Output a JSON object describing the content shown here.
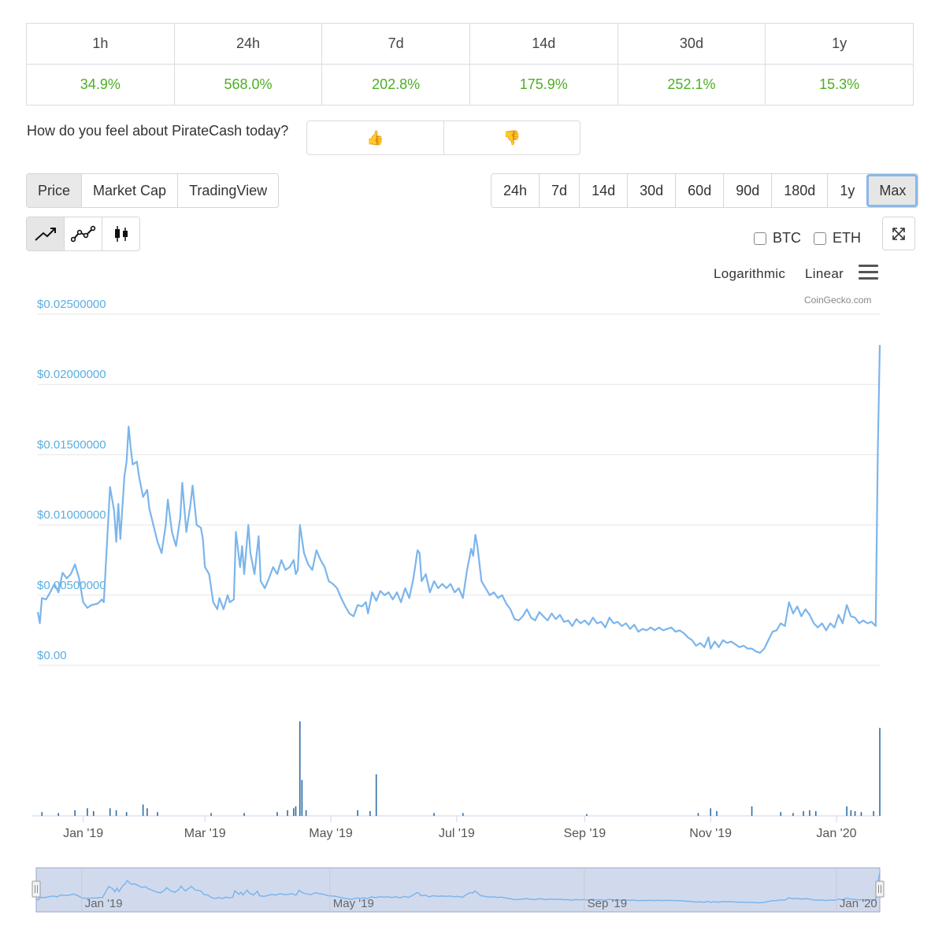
{
  "change": {
    "periods": [
      "1h",
      "24h",
      "7d",
      "14d",
      "30d",
      "1y"
    ],
    "values": [
      "34.9%",
      "568.0%",
      "202.8%",
      "175.9%",
      "252.1%",
      "15.3%"
    ]
  },
  "sentiment": {
    "question": "How do you feel about PirateCash today?",
    "up_icon": "👍",
    "down_icon": "👎"
  },
  "tabs": [
    "Price",
    "Market Cap",
    "TradingView"
  ],
  "ranges": [
    "24h",
    "7d",
    "14d",
    "30d",
    "60d",
    "90d",
    "180d",
    "1y",
    "Max"
  ],
  "compare": {
    "btc": "BTC",
    "eth": "ETH"
  },
  "scale": {
    "log": "Logarithmic",
    "linear": "Linear"
  },
  "credit": "CoinGecko.com",
  "colors": {
    "line": "#7cb5ec",
    "volume": "#2f6ca4",
    "axis_label": "#5aaee0",
    "green": "#4caf22"
  },
  "chart_data": {
    "type": "line",
    "ylim": [
      0,
      0.025
    ],
    "yticks": [
      "$0.02500000",
      "$0.02000000",
      "$0.01500000",
      "$0.01000000",
      "$0.00500000",
      "$0.00"
    ],
    "xticks": [
      "Jan '19",
      "Mar '19",
      "May '19",
      "Jul '19",
      "Sep '19",
      "Nov '19",
      "Jan '20"
    ],
    "navigator_ticks": [
      "Jan '19",
      "May '19",
      "Sep '19",
      "Jan '20"
    ],
    "x_start": "2018-12-10",
    "x_end": "2020-01-22",
    "series": [
      {
        "type": "price",
        "points": [
          [
            "2018-12-10",
            0.0038
          ],
          [
            "2018-12-11",
            0.003
          ],
          [
            "2018-12-12",
            0.0048
          ],
          [
            "2018-12-14",
            0.0047
          ],
          [
            "2018-12-16",
            0.0052
          ],
          [
            "2018-12-18",
            0.0058
          ],
          [
            "2018-12-20",
            0.0052
          ],
          [
            "2018-12-22",
            0.0066
          ],
          [
            "2018-12-24",
            0.0062
          ],
          [
            "2018-12-26",
            0.0065
          ],
          [
            "2018-12-28",
            0.0072
          ],
          [
            "2018-12-30",
            0.0062
          ],
          [
            "2019-01-01",
            0.0045
          ],
          [
            "2019-01-03",
            0.0041
          ],
          [
            "2019-01-05",
            0.0043
          ],
          [
            "2019-01-08",
            0.0044
          ],
          [
            "2019-01-10",
            0.0047
          ],
          [
            "2019-01-11",
            0.0045
          ],
          [
            "2019-01-13",
            0.01
          ],
          [
            "2019-01-14",
            0.0127
          ],
          [
            "2019-01-16",
            0.011
          ],
          [
            "2019-01-17",
            0.0088
          ],
          [
            "2019-01-18",
            0.0115
          ],
          [
            "2019-01-19",
            0.009
          ],
          [
            "2019-01-21",
            0.0135
          ],
          [
            "2019-01-22",
            0.0145
          ],
          [
            "2019-01-23",
            0.017
          ],
          [
            "2019-01-24",
            0.0155
          ],
          [
            "2019-01-25",
            0.0143
          ],
          [
            "2019-01-27",
            0.0145
          ],
          [
            "2019-01-28",
            0.0135
          ],
          [
            "2019-01-30",
            0.012
          ],
          [
            "2019-02-01",
            0.0125
          ],
          [
            "2019-02-02",
            0.0112
          ],
          [
            "2019-02-04",
            0.01
          ],
          [
            "2019-02-06",
            0.0088
          ],
          [
            "2019-02-08",
            0.008
          ],
          [
            "2019-02-10",
            0.01
          ],
          [
            "2019-02-11",
            0.0118
          ],
          [
            "2019-02-13",
            0.0095
          ],
          [
            "2019-02-15",
            0.0085
          ],
          [
            "2019-02-17",
            0.0105
          ],
          [
            "2019-02-18",
            0.013
          ],
          [
            "2019-02-20",
            0.0095
          ],
          [
            "2019-02-22",
            0.0115
          ],
          [
            "2019-02-23",
            0.0128
          ],
          [
            "2019-02-25",
            0.01
          ],
          [
            "2019-02-27",
            0.0098
          ],
          [
            "2019-02-28",
            0.009
          ],
          [
            "2019-03-01",
            0.007
          ],
          [
            "2019-03-03",
            0.0065
          ],
          [
            "2019-03-05",
            0.0045
          ],
          [
            "2019-03-07",
            0.004
          ],
          [
            "2019-03-08",
            0.0048
          ],
          [
            "2019-03-10",
            0.004
          ],
          [
            "2019-03-12",
            0.005
          ],
          [
            "2019-03-13",
            0.0045
          ],
          [
            "2019-03-15",
            0.0047
          ],
          [
            "2019-03-16",
            0.0095
          ],
          [
            "2019-03-18",
            0.007
          ],
          [
            "2019-03-19",
            0.0085
          ],
          [
            "2019-03-20",
            0.0065
          ],
          [
            "2019-03-22",
            0.01
          ],
          [
            "2019-03-23",
            0.008
          ],
          [
            "2019-03-25",
            0.0065
          ],
          [
            "2019-03-27",
            0.0092
          ],
          [
            "2019-03-28",
            0.006
          ],
          [
            "2019-03-30",
            0.0055
          ],
          [
            "2019-04-01",
            0.0062
          ],
          [
            "2019-04-03",
            0.007
          ],
          [
            "2019-04-05",
            0.0065
          ],
          [
            "2019-04-07",
            0.0075
          ],
          [
            "2019-04-09",
            0.0068
          ],
          [
            "2019-04-11",
            0.007
          ],
          [
            "2019-04-13",
            0.0075
          ],
          [
            "2019-04-14",
            0.0065
          ],
          [
            "2019-04-15",
            0.0068
          ],
          [
            "2019-04-16",
            0.01
          ],
          [
            "2019-04-18",
            0.008
          ],
          [
            "2019-04-20",
            0.0072
          ],
          [
            "2019-04-22",
            0.0068
          ],
          [
            "2019-04-24",
            0.0082
          ],
          [
            "2019-04-26",
            0.0075
          ],
          [
            "2019-04-28",
            0.007
          ],
          [
            "2019-04-30",
            0.006
          ],
          [
            "2019-05-02",
            0.0058
          ],
          [
            "2019-05-04",
            0.0055
          ],
          [
            "2019-05-06",
            0.0048
          ],
          [
            "2019-05-08",
            0.0042
          ],
          [
            "2019-05-10",
            0.0037
          ],
          [
            "2019-05-12",
            0.0035
          ],
          [
            "2019-05-14",
            0.0043
          ],
          [
            "2019-05-16",
            0.0042
          ],
          [
            "2019-05-18",
            0.0045
          ],
          [
            "2019-05-19",
            0.0037
          ],
          [
            "2019-05-21",
            0.0052
          ],
          [
            "2019-05-23",
            0.0046
          ],
          [
            "2019-05-25",
            0.0053
          ],
          [
            "2019-05-27",
            0.005
          ],
          [
            "2019-05-29",
            0.0052
          ],
          [
            "2019-05-31",
            0.0047
          ],
          [
            "2019-06-02",
            0.0052
          ],
          [
            "2019-06-04",
            0.0045
          ],
          [
            "2019-06-06",
            0.0055
          ],
          [
            "2019-06-08",
            0.0048
          ],
          [
            "2019-06-10",
            0.0062
          ],
          [
            "2019-06-12",
            0.0082
          ],
          [
            "2019-06-13",
            0.008
          ],
          [
            "2019-06-14",
            0.006
          ],
          [
            "2019-06-16",
            0.0065
          ],
          [
            "2019-06-18",
            0.0052
          ],
          [
            "2019-06-20",
            0.006
          ],
          [
            "2019-06-22",
            0.0055
          ],
          [
            "2019-06-24",
            0.0058
          ],
          [
            "2019-06-26",
            0.0055
          ],
          [
            "2019-06-28",
            0.0058
          ],
          [
            "2019-06-30",
            0.0052
          ],
          [
            "2019-07-02",
            0.0055
          ],
          [
            "2019-07-04",
            0.0048
          ],
          [
            "2019-07-06",
            0.0068
          ],
          [
            "2019-07-08",
            0.0083
          ],
          [
            "2019-07-09",
            0.0078
          ],
          [
            "2019-07-10",
            0.0093
          ],
          [
            "2019-07-11",
            0.0085
          ],
          [
            "2019-07-13",
            0.006
          ],
          [
            "2019-07-15",
            0.0055
          ],
          [
            "2019-07-17",
            0.005
          ],
          [
            "2019-07-19",
            0.0052
          ],
          [
            "2019-07-21",
            0.0048
          ],
          [
            "2019-07-23",
            0.005
          ],
          [
            "2019-07-25",
            0.0044
          ],
          [
            "2019-07-27",
            0.004
          ],
          [
            "2019-07-29",
            0.0033
          ],
          [
            "2019-07-31",
            0.0032
          ],
          [
            "2019-08-02",
            0.0035
          ],
          [
            "2019-08-04",
            0.004
          ],
          [
            "2019-08-06",
            0.0034
          ],
          [
            "2019-08-08",
            0.0032
          ],
          [
            "2019-08-10",
            0.0038
          ],
          [
            "2019-08-12",
            0.0035
          ],
          [
            "2019-08-14",
            0.0032
          ],
          [
            "2019-08-16",
            0.0037
          ],
          [
            "2019-08-18",
            0.0033
          ],
          [
            "2019-08-20",
            0.0036
          ],
          [
            "2019-08-22",
            0.0031
          ],
          [
            "2019-08-24",
            0.0032
          ],
          [
            "2019-08-26",
            0.0028
          ],
          [
            "2019-08-28",
            0.0033
          ],
          [
            "2019-08-30",
            0.003
          ],
          [
            "2019-09-01",
            0.0032
          ],
          [
            "2019-09-03",
            0.0029
          ],
          [
            "2019-09-05",
            0.0034
          ],
          [
            "2019-09-07",
            0.003
          ],
          [
            "2019-09-09",
            0.0031
          ],
          [
            "2019-09-11",
            0.0027
          ],
          [
            "2019-09-13",
            0.0034
          ],
          [
            "2019-09-15",
            0.003
          ],
          [
            "2019-09-17",
            0.0031
          ],
          [
            "2019-09-19",
            0.0028
          ],
          [
            "2019-09-21",
            0.003
          ],
          [
            "2019-09-23",
            0.0026
          ],
          [
            "2019-09-25",
            0.0029
          ],
          [
            "2019-09-27",
            0.0024
          ],
          [
            "2019-09-29",
            0.0026
          ],
          [
            "2019-10-01",
            0.0025
          ],
          [
            "2019-10-03",
            0.0027
          ],
          [
            "2019-10-05",
            0.0025
          ],
          [
            "2019-10-07",
            0.0027
          ],
          [
            "2019-10-09",
            0.0025
          ],
          [
            "2019-10-11",
            0.0026
          ],
          [
            "2019-10-13",
            0.0027
          ],
          [
            "2019-10-15",
            0.0024
          ],
          [
            "2019-10-17",
            0.0025
          ],
          [
            "2019-10-19",
            0.0023
          ],
          [
            "2019-10-21",
            0.002
          ],
          [
            "2019-10-23",
            0.0018
          ],
          [
            "2019-10-25",
            0.0014
          ],
          [
            "2019-10-27",
            0.0016
          ],
          [
            "2019-10-29",
            0.0013
          ],
          [
            "2019-10-31",
            0.002
          ],
          [
            "2019-11-01",
            0.0012
          ],
          [
            "2019-11-03",
            0.0017
          ],
          [
            "2019-11-05",
            0.0013
          ],
          [
            "2019-11-07",
            0.0018
          ],
          [
            "2019-11-09",
            0.0016
          ],
          [
            "2019-11-11",
            0.0017
          ],
          [
            "2019-11-13",
            0.0015
          ],
          [
            "2019-11-15",
            0.0013
          ],
          [
            "2019-11-17",
            0.0014
          ],
          [
            "2019-11-19",
            0.0012
          ],
          [
            "2019-11-21",
            0.0012
          ],
          [
            "2019-11-23",
            0.001
          ],
          [
            "2019-11-25",
            0.0009
          ],
          [
            "2019-11-27",
            0.0012
          ],
          [
            "2019-11-29",
            0.0018
          ],
          [
            "2019-12-01",
            0.0024
          ],
          [
            "2019-12-03",
            0.0025
          ],
          [
            "2019-12-05",
            0.003
          ],
          [
            "2019-12-07",
            0.0028
          ],
          [
            "2019-12-09",
            0.0045
          ],
          [
            "2019-12-11",
            0.0037
          ],
          [
            "2019-12-13",
            0.0042
          ],
          [
            "2019-12-15",
            0.0035
          ],
          [
            "2019-12-17",
            0.004
          ],
          [
            "2019-12-19",
            0.0036
          ],
          [
            "2019-12-21",
            0.003
          ],
          [
            "2019-12-23",
            0.0027
          ],
          [
            "2019-12-25",
            0.003
          ],
          [
            "2019-12-27",
            0.0025
          ],
          [
            "2019-12-29",
            0.003
          ],
          [
            "2019-12-31",
            0.0027
          ],
          [
            "2020-01-02",
            0.0036
          ],
          [
            "2020-01-04",
            0.003
          ],
          [
            "2020-01-06",
            0.0043
          ],
          [
            "2020-01-08",
            0.0035
          ],
          [
            "2020-01-10",
            0.0034
          ],
          [
            "2020-01-12",
            0.003
          ],
          [
            "2020-01-14",
            0.0032
          ],
          [
            "2020-01-16",
            0.003
          ],
          [
            "2020-01-18",
            0.0031
          ],
          [
            "2020-01-20",
            0.0028
          ],
          [
            "2020-01-21",
            0.015
          ],
          [
            "2020-01-22",
            0.0228
          ]
        ]
      },
      {
        "type": "volume",
        "bars": [
          [
            "2018-12-12",
            0.04
          ],
          [
            "2018-12-20",
            0.03
          ],
          [
            "2018-12-28",
            0.06
          ],
          [
            "2019-01-03",
            0.08
          ],
          [
            "2019-01-06",
            0.05
          ],
          [
            "2019-01-14",
            0.08
          ],
          [
            "2019-01-17",
            0.06
          ],
          [
            "2019-01-22",
            0.04
          ],
          [
            "2019-01-30",
            0.12
          ],
          [
            "2019-02-01",
            0.08
          ],
          [
            "2019-02-06",
            0.04
          ],
          [
            "2019-03-04",
            0.03
          ],
          [
            "2019-03-20",
            0.03
          ],
          [
            "2019-04-05",
            0.04
          ],
          [
            "2019-04-10",
            0.06
          ],
          [
            "2019-04-13",
            0.08
          ],
          [
            "2019-04-14",
            0.1
          ],
          [
            "2019-04-16",
            1.0
          ],
          [
            "2019-04-17",
            0.38
          ],
          [
            "2019-04-19",
            0.06
          ],
          [
            "2019-05-14",
            0.06
          ],
          [
            "2019-05-20",
            0.05
          ],
          [
            "2019-05-23",
            0.44
          ],
          [
            "2019-06-20",
            0.03
          ],
          [
            "2019-07-04",
            0.03
          ],
          [
            "2019-09-02",
            0.02
          ],
          [
            "2019-10-26",
            0.03
          ],
          [
            "2019-11-01",
            0.08
          ],
          [
            "2019-11-04",
            0.05
          ],
          [
            "2019-11-21",
            0.1
          ],
          [
            "2019-12-05",
            0.04
          ],
          [
            "2019-12-11",
            0.03
          ],
          [
            "2019-12-16",
            0.05
          ],
          [
            "2019-12-19",
            0.06
          ],
          [
            "2019-12-22",
            0.05
          ],
          [
            "2020-01-06",
            0.1
          ],
          [
            "2020-01-08",
            0.06
          ],
          [
            "2020-01-10",
            0.05
          ],
          [
            "2020-01-13",
            0.04
          ],
          [
            "2020-01-19",
            0.05
          ],
          [
            "2020-01-22",
            0.93
          ]
        ]
      }
    ]
  }
}
